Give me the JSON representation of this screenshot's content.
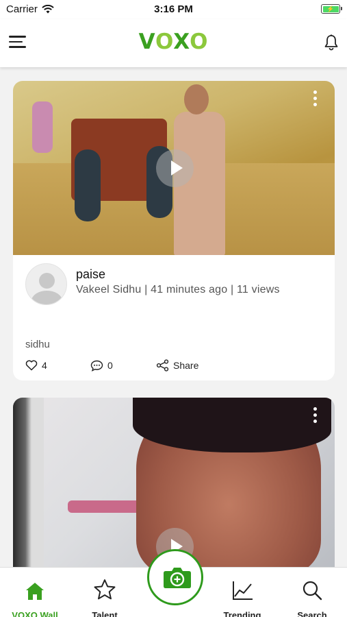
{
  "status_bar": {
    "carrier": "Carrier",
    "time": "3:16 PM"
  },
  "header": {
    "logo_v": "V",
    "logo_o1": "O",
    "logo_x": "X",
    "logo_o2": "O",
    "menu_icon": "hamburger-icon",
    "notification_icon": "bell-icon"
  },
  "feed": {
    "posts": [
      {
        "title": "paise",
        "author": "Vakeel Sidhu",
        "time_ago": "41 minutes ago",
        "views": "11 views",
        "meta": "Vakeel Sidhu | 41 minutes ago | 11 views",
        "description": "sidhu",
        "likes": "4",
        "comments": "0",
        "share_label": "Share"
      },
      {
        "title": "",
        "meta": ""
      }
    ]
  },
  "tabbar": {
    "tabs": [
      {
        "label": "VOXO Wall",
        "icon": "home-icon",
        "active": true
      },
      {
        "label": "Talent",
        "icon": "star-icon",
        "active": false
      },
      {
        "label": "Trending",
        "icon": "trending-chart-icon",
        "active": false
      },
      {
        "label": "Search",
        "icon": "search-icon",
        "active": false
      }
    ],
    "center_button_icon": "camera-plus-icon"
  },
  "colors": {
    "brand_green": "#3aa020",
    "brand_light_green": "#8cc83c",
    "battery_green": "#4cd964"
  }
}
